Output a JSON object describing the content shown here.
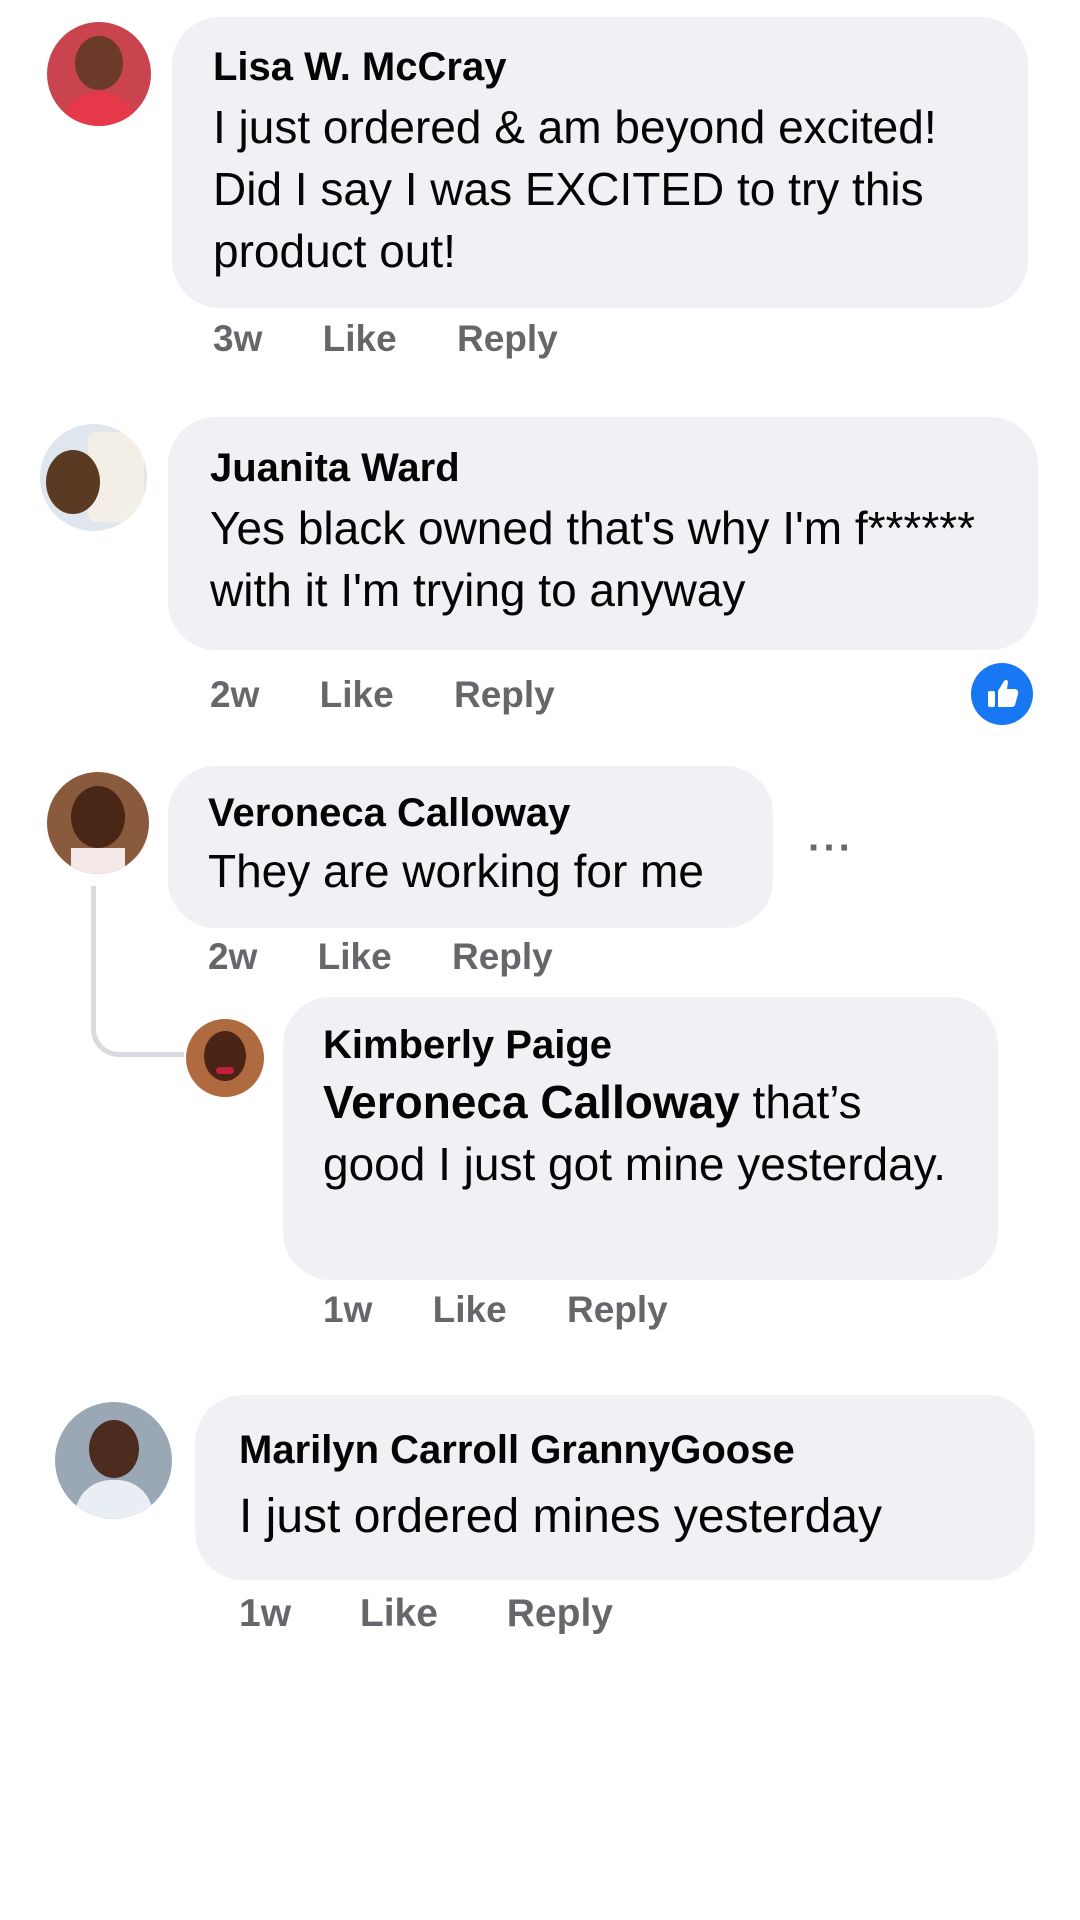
{
  "colors": {
    "bubble": "#f0f0f5",
    "meta_text": "#65676b",
    "like_reaction": "#1877f2"
  },
  "reaction_icon": "thumbs-up-icon",
  "more_icon": "more-options-icon",
  "comments": [
    {
      "author": "Lisa W. McCray",
      "text": "I just ordered & am beyond excited! Did I say I was EXCITED to try this product out!",
      "time": "3w",
      "like": "Like",
      "reply": "Reply"
    },
    {
      "author": "Juanita Ward",
      "text": "Yes black owned that's why I'm f****** with it I'm trying to anyway",
      "time": "2w",
      "like": "Like",
      "reply": "Reply"
    },
    {
      "author": "Veroneca Calloway",
      "text": "They are working for me",
      "time": "2w",
      "like": "Like",
      "reply": "Reply",
      "more": "···"
    },
    {
      "author": "Kimberly Paige",
      "mention": "Veroneca Calloway",
      "text": " that’s good I just got mine yesterday.",
      "time": "1w",
      "like": "Like",
      "reply": "Reply"
    },
    {
      "author": "Marilyn Carroll GrannyGoose",
      "text": "I just ordered mines yesterday",
      "time": "1w",
      "like": "Like",
      "reply": "Reply"
    }
  ]
}
